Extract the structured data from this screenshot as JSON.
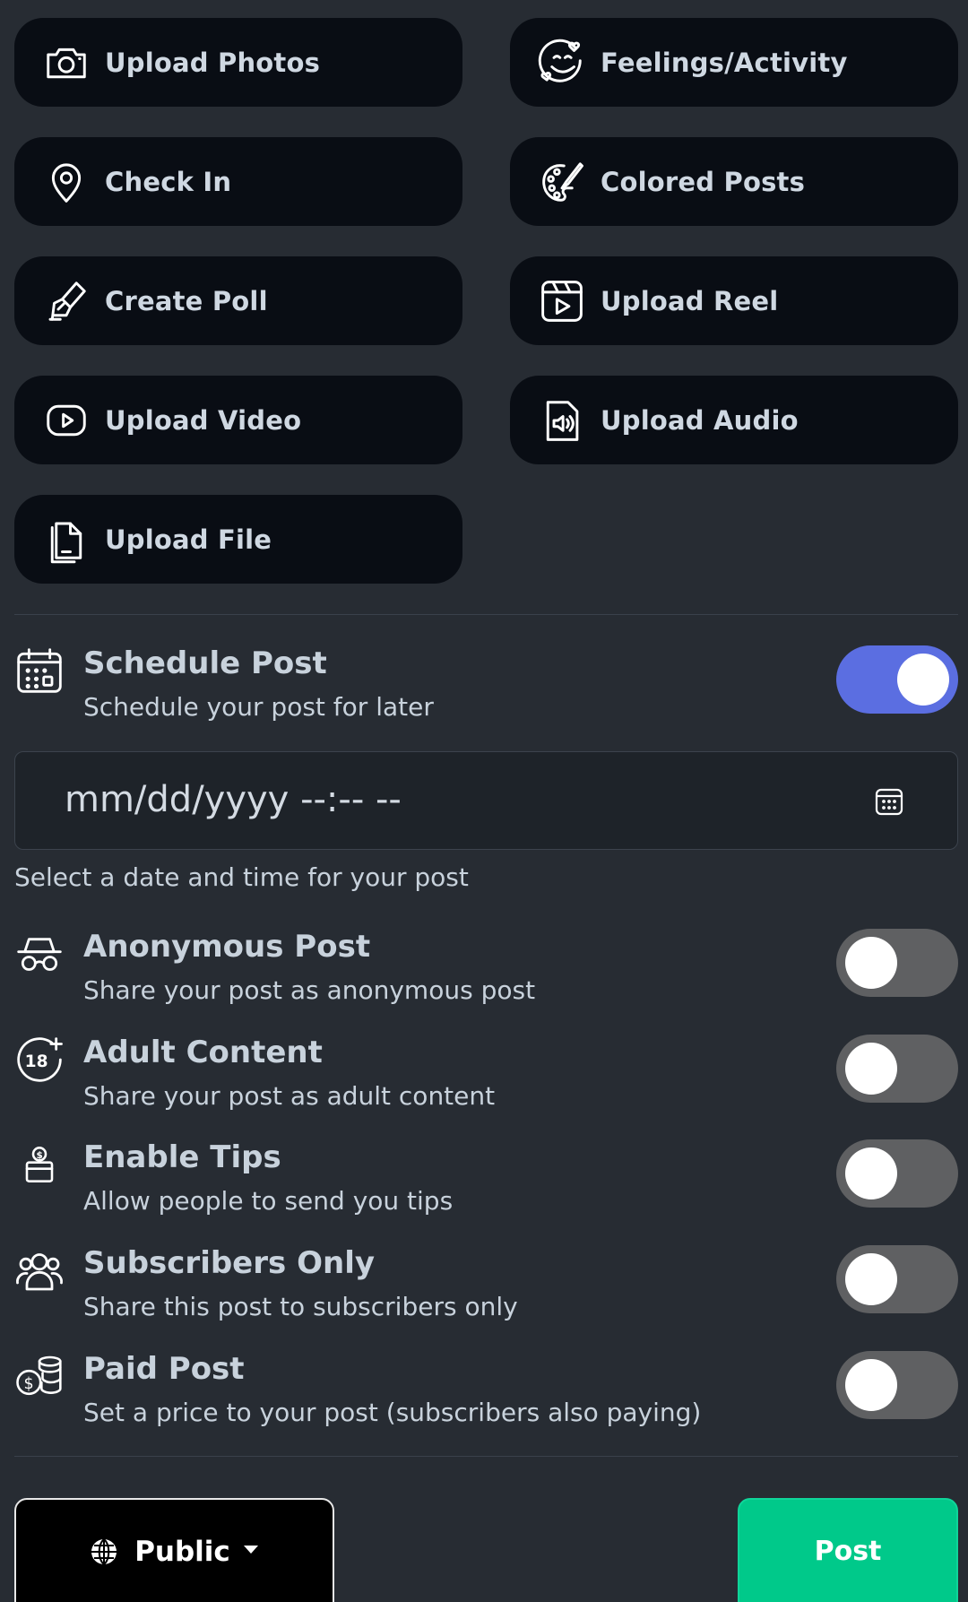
{
  "actions": [
    {
      "label": "Upload Photos",
      "icon": "camera-icon"
    },
    {
      "label": "Feelings/Activity",
      "icon": "smiley-icon"
    },
    {
      "label": "Check In",
      "icon": "map-pin-icon"
    },
    {
      "label": "Colored Posts",
      "icon": "palette-icon"
    },
    {
      "label": "Create Poll",
      "icon": "poll-icon"
    },
    {
      "label": "Upload Reel",
      "icon": "reel-icon"
    },
    {
      "label": "Upload Video",
      "icon": "video-play-icon"
    },
    {
      "label": "Upload Audio",
      "icon": "audio-file-icon"
    },
    {
      "label": "Upload File",
      "icon": "file-icon"
    }
  ],
  "schedule": {
    "title": "Schedule Post",
    "description": "Schedule your post for later",
    "enabled": true,
    "date_value": "mm/dd/yyyy --:-- --",
    "hint": "Select a date and time for your post"
  },
  "settings": {
    "anonymous": {
      "title": "Anonymous Post",
      "description": "Share your post as anonymous post",
      "enabled": false
    },
    "adult": {
      "title": "Adult Content",
      "description": "Share your post as adult content",
      "enabled": false
    },
    "tips": {
      "title": "Enable Tips",
      "description": "Allow people to send you tips",
      "enabled": false
    },
    "subscribers": {
      "title": "Subscribers Only",
      "description": "Share this post to subscribers only",
      "enabled": false
    },
    "paid": {
      "title": "Paid Post",
      "description": "Set a price to your post (subscribers also paying)",
      "enabled": false
    }
  },
  "footer": {
    "privacy_label": "Public",
    "post_label": "Post"
  },
  "colors": {
    "background": "#272c33",
    "button_bg": "#090d14",
    "toggle_on": "#5b6ee1",
    "toggle_off": "#5f6062",
    "post_button": "#00c98a"
  }
}
